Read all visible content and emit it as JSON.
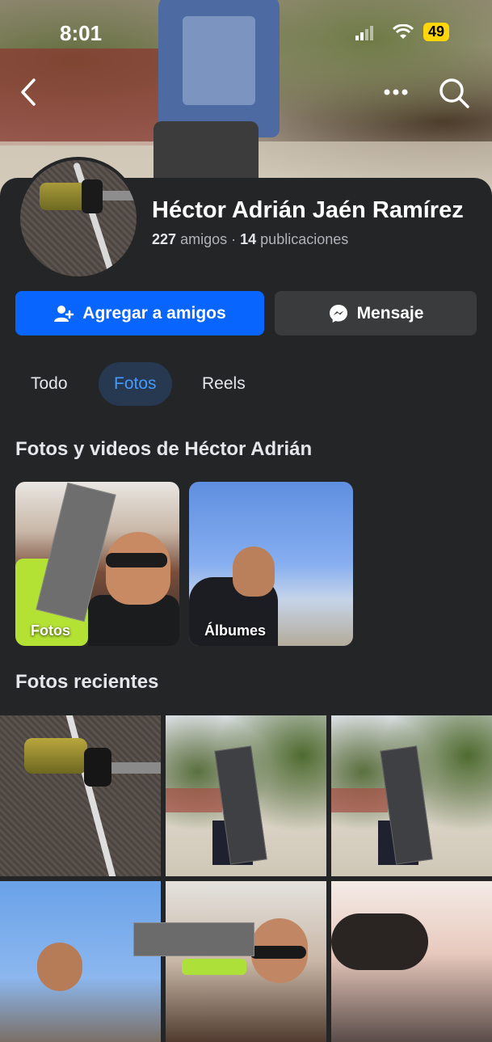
{
  "status_bar": {
    "time": "8:01",
    "battery": "49"
  },
  "profile": {
    "name": "Héctor Adrián Jaén Ramírez",
    "friends_count": "227",
    "friends_label": "amigos",
    "separator": "·",
    "posts_count": "14",
    "posts_label": "publicaciones"
  },
  "actions": {
    "add_friend": "Agregar a amigos",
    "message": "Mensaje"
  },
  "tabs": [
    {
      "label": "Todo",
      "selected": false
    },
    {
      "label": "Fotos",
      "selected": true
    },
    {
      "label": "Reels",
      "selected": false
    }
  ],
  "sections": {
    "media_title": "Fotos y videos de Héctor Adrián",
    "recent_title": "Fotos recientes"
  },
  "albums": [
    {
      "label": "Fotos"
    },
    {
      "label": "Álbumes"
    }
  ],
  "icons": {
    "back": "chevron-left-icon",
    "more": "more-horizontal-icon",
    "search": "search-icon",
    "add_friend": "person-add-icon",
    "message": "messenger-icon"
  },
  "colors": {
    "accent": "#0866ff",
    "tab_selected_bg": "#263951",
    "tab_selected_text": "#4599ff",
    "background": "#242526"
  }
}
